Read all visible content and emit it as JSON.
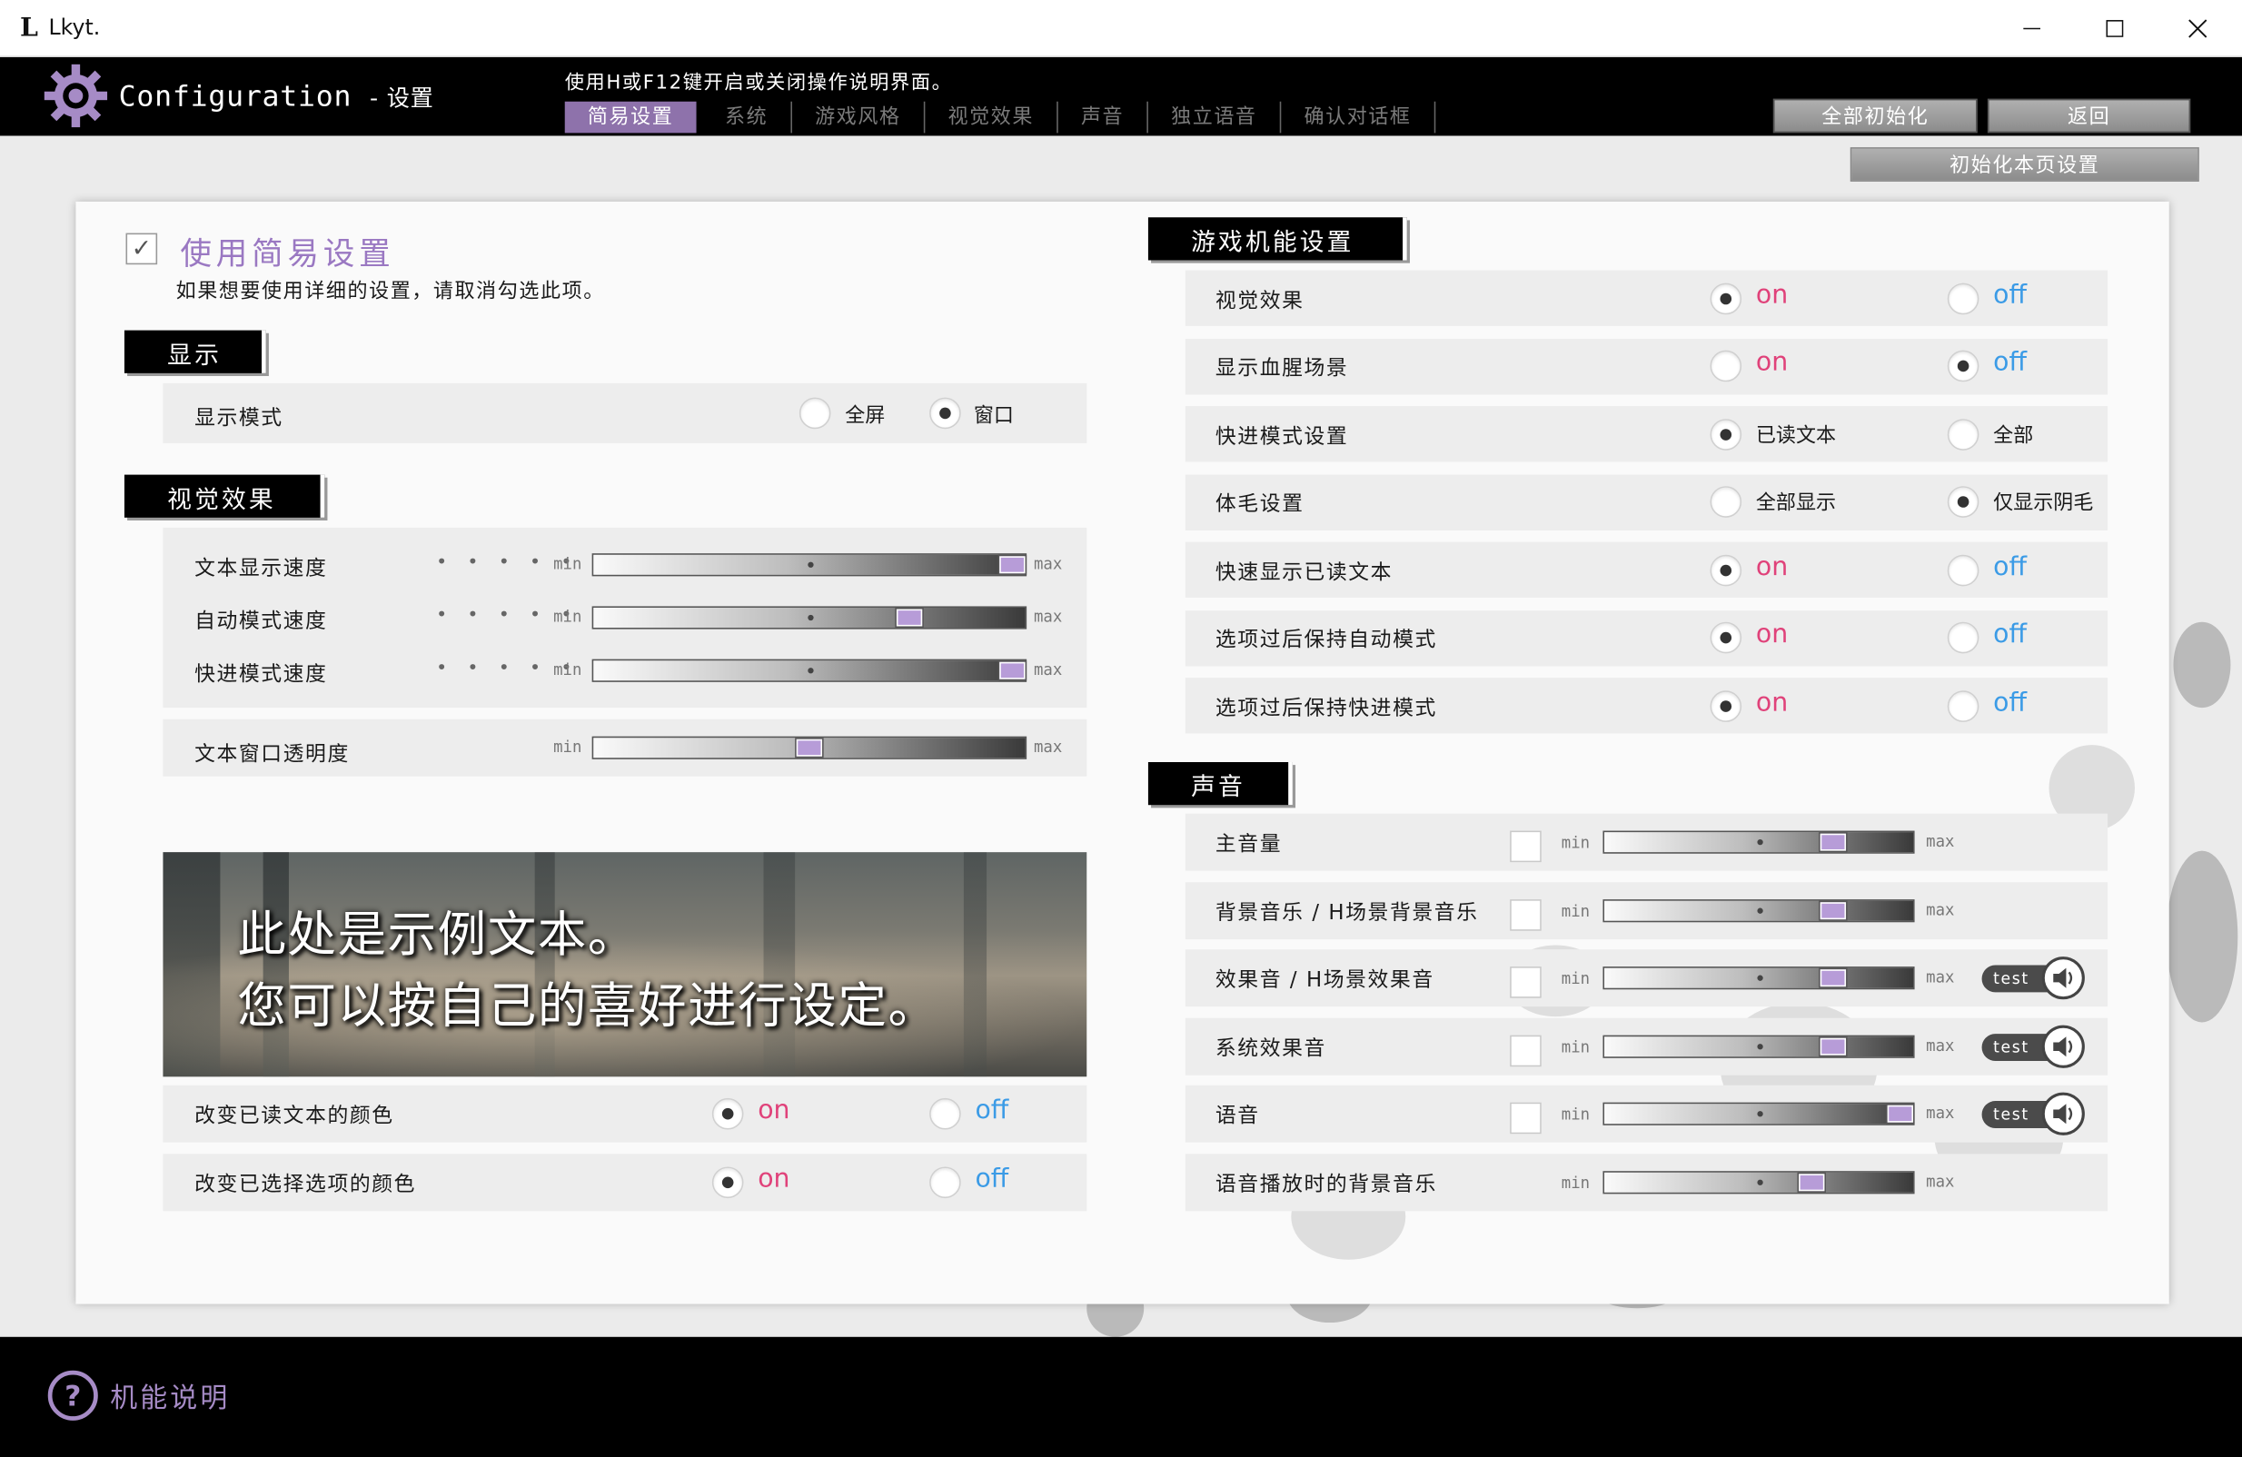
{
  "window": {
    "title": "Lkyt.",
    "logo": "L",
    "controls": {
      "minimize": "—",
      "maximize": "☐",
      "close": "✕"
    }
  },
  "header": {
    "title": "Configuration",
    "title_suffix": "- 设置",
    "hint": "使用H或F12键开启或关闭操作说明界面。",
    "tabs": [
      "简易设置",
      "系统",
      "游戏风格",
      "视觉效果",
      "声音",
      "独立语音",
      "确认对话框"
    ],
    "active_tab": "简易设置",
    "reset_all": "全部初始化",
    "back": "返回",
    "reset_page": "初始化本页设置"
  },
  "simple": {
    "checked": true,
    "title": "使用简易设置",
    "note": "如果想要使用详细的设置，请取消勾选此项。"
  },
  "display": {
    "section": "显示",
    "mode_label": "显示模式",
    "options": [
      "全屏",
      "窗口"
    ],
    "selected": "窗口"
  },
  "visual": {
    "section": "视觉效果",
    "sliders": [
      {
        "label": "文本显示速度",
        "dots": "• • • • •",
        "value": 0.97
      },
      {
        "label": "自动模式速度",
        "dots": "• • • • •",
        "value": 0.73
      },
      {
        "label": "快进模式速度",
        "dots": "• • • • •",
        "value": 0.97
      }
    ],
    "opacity": {
      "label": "文本窗口透明度",
      "value": 0.5
    },
    "min": "min",
    "max": "max"
  },
  "preview": {
    "line1": "此处是示例文本。",
    "line2": "您可以按自己的喜好进行设定。"
  },
  "color_rows": [
    {
      "label": "改变已读文本的颜色",
      "on": "on",
      "off": "off",
      "selected": "on"
    },
    {
      "label": "改变已选择选项的颜色",
      "on": "on",
      "off": "off",
      "selected": "on"
    }
  ],
  "game": {
    "section": "游戏机能设置",
    "rows": [
      {
        "label": "视觉效果",
        "a": "on",
        "b": "off",
        "selected": "a",
        "style": "onoff"
      },
      {
        "label": "显示血腥场景",
        "a": "on",
        "b": "off",
        "selected": "b",
        "style": "onoff"
      },
      {
        "label": "快进模式设置",
        "a": "已读文本",
        "b": "全部",
        "selected": "a",
        "style": "text"
      },
      {
        "label": "体毛设置",
        "a": "全部显示",
        "b": "仅显示阴毛",
        "selected": "b",
        "style": "text"
      },
      {
        "label": "快速显示已读文本",
        "a": "on",
        "b": "off",
        "selected": "a",
        "style": "onoff"
      },
      {
        "label": "选项过后保持自动模式",
        "a": "on",
        "b": "off",
        "selected": "a",
        "style": "onoff"
      },
      {
        "label": "选项过后保持快进模式",
        "a": "on",
        "b": "off",
        "selected": "a",
        "style": "onoff"
      }
    ]
  },
  "sound": {
    "section": "声音",
    "min": "min",
    "max": "max",
    "test": "test",
    "rows": [
      {
        "label": "主音量",
        "value": 0.74,
        "mute": true,
        "test": false
      },
      {
        "label": "背景音乐 / H场景背景音乐",
        "value": 0.74,
        "mute": true,
        "test": false
      },
      {
        "label": "效果音 / H场景效果音",
        "value": 0.74,
        "mute": true,
        "test": true
      },
      {
        "label": "系统效果音",
        "value": 0.74,
        "mute": true,
        "test": true
      },
      {
        "label": "语音",
        "value": 0.97,
        "mute": true,
        "test": true
      },
      {
        "label": "语音播放时的背景音乐",
        "value": 0.67,
        "mute": false,
        "test": false
      }
    ]
  },
  "footer": {
    "help": "机能说明"
  },
  "colors": {
    "accent": "#8e72ab",
    "on": "#e0427a",
    "off": "#3b9be6",
    "knob": "#b79cd8"
  }
}
